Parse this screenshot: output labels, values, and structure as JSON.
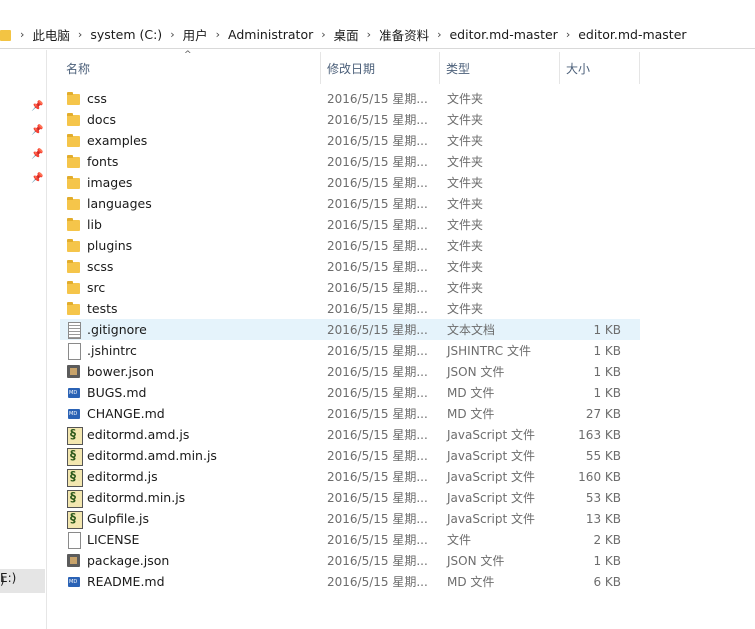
{
  "breadcrumb": [
    "此电脑",
    "system (C:)",
    "用户",
    "Administrator",
    "桌面",
    "准备资料",
    "editor.md-master",
    "editor.md-master"
  ],
  "columns": {
    "name": "名称",
    "date": "修改日期",
    "type": "类型",
    "size": "大小"
  },
  "nav": {
    "item1": ")",
    "item2": "E:)"
  },
  "files": [
    {
      "name": "css",
      "date": "2016/5/15 星期...",
      "type": "文件夹",
      "size": "",
      "icon": "folder"
    },
    {
      "name": "docs",
      "date": "2016/5/15 星期...",
      "type": "文件夹",
      "size": "",
      "icon": "folder"
    },
    {
      "name": "examples",
      "date": "2016/5/15 星期...",
      "type": "文件夹",
      "size": "",
      "icon": "folder"
    },
    {
      "name": "fonts",
      "date": "2016/5/15 星期...",
      "type": "文件夹",
      "size": "",
      "icon": "folder"
    },
    {
      "name": "images",
      "date": "2016/5/15 星期...",
      "type": "文件夹",
      "size": "",
      "icon": "folder"
    },
    {
      "name": "languages",
      "date": "2016/5/15 星期...",
      "type": "文件夹",
      "size": "",
      "icon": "folder"
    },
    {
      "name": "lib",
      "date": "2016/5/15 星期...",
      "type": "文件夹",
      "size": "",
      "icon": "folder"
    },
    {
      "name": "plugins",
      "date": "2016/5/15 星期...",
      "type": "文件夹",
      "size": "",
      "icon": "folder"
    },
    {
      "name": "scss",
      "date": "2016/5/15 星期...",
      "type": "文件夹",
      "size": "",
      "icon": "folder"
    },
    {
      "name": "src",
      "date": "2016/5/15 星期...",
      "type": "文件夹",
      "size": "",
      "icon": "folder"
    },
    {
      "name": "tests",
      "date": "2016/5/15 星期...",
      "type": "文件夹",
      "size": "",
      "icon": "folder"
    },
    {
      "name": ".gitignore",
      "date": "2016/5/15 星期...",
      "type": "文本文档",
      "size": "1 KB",
      "icon": "text",
      "selected": true
    },
    {
      "name": ".jshintrc",
      "date": "2016/5/15 星期...",
      "type": "JSHINTRC 文件",
      "size": "1 KB",
      "icon": "doc"
    },
    {
      "name": "bower.json",
      "date": "2016/5/15 星期...",
      "type": "JSON 文件",
      "size": "1 KB",
      "icon": "json"
    },
    {
      "name": "BUGS.md",
      "date": "2016/5/15 星期...",
      "type": "MD 文件",
      "size": "1 KB",
      "icon": "md"
    },
    {
      "name": "CHANGE.md",
      "date": "2016/5/15 星期...",
      "type": "MD 文件",
      "size": "27 KB",
      "icon": "md"
    },
    {
      "name": "editormd.amd.js",
      "date": "2016/5/15 星期...",
      "type": "JavaScript 文件",
      "size": "163 KB",
      "icon": "js"
    },
    {
      "name": "editormd.amd.min.js",
      "date": "2016/5/15 星期...",
      "type": "JavaScript 文件",
      "size": "55 KB",
      "icon": "js"
    },
    {
      "name": "editormd.js",
      "date": "2016/5/15 星期...",
      "type": "JavaScript 文件",
      "size": "160 KB",
      "icon": "js"
    },
    {
      "name": "editormd.min.js",
      "date": "2016/5/15 星期...",
      "type": "JavaScript 文件",
      "size": "53 KB",
      "icon": "js"
    },
    {
      "name": "Gulpfile.js",
      "date": "2016/5/15 星期...",
      "type": "JavaScript 文件",
      "size": "13 KB",
      "icon": "js"
    },
    {
      "name": "LICENSE",
      "date": "2016/5/15 星期...",
      "type": "文件",
      "size": "2 KB",
      "icon": "doc"
    },
    {
      "name": "package.json",
      "date": "2016/5/15 星期...",
      "type": "JSON 文件",
      "size": "1 KB",
      "icon": "json"
    },
    {
      "name": "README.md",
      "date": "2016/5/15 星期...",
      "type": "MD 文件",
      "size": "6 KB",
      "icon": "md"
    }
  ]
}
